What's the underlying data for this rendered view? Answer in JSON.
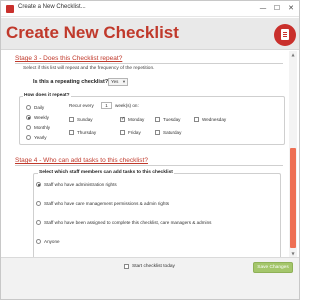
{
  "window": {
    "title": "Create a New Checklist...",
    "controls": {
      "minimize": "—",
      "maximize": "☐",
      "close": "✕"
    }
  },
  "header": {
    "title": "Create New Checklist",
    "logo_icon": "checklist-document-icon",
    "brand_color": "#c0392b"
  },
  "stage3": {
    "heading": "Stage 3 - Does this Checklist repeat?",
    "description": "Select if this list will repeat and the frequency of the repetition.",
    "repeating_label": "Is this a repeating checklist?:",
    "repeating_value": "Yes",
    "repeat_box": {
      "legend": "How does it repeat?",
      "frequencies": [
        {
          "label": "Daily",
          "selected": false
        },
        {
          "label": "Weekly",
          "selected": true
        },
        {
          "label": "Monthly",
          "selected": false
        },
        {
          "label": "Yearly",
          "selected": false
        }
      ],
      "recur_prefix": "Recur every",
      "recur_value": "1",
      "recur_suffix": "week(s) on:",
      "days": [
        {
          "label": "Sunday",
          "checked": false
        },
        {
          "label": "Monday",
          "checked": true
        },
        {
          "label": "Tuesday",
          "checked": false
        },
        {
          "label": "Wednesday",
          "checked": false
        },
        {
          "label": "Thursday",
          "checked": false
        },
        {
          "label": "Friday",
          "checked": false
        },
        {
          "label": "Saturday",
          "checked": false
        }
      ]
    }
  },
  "stage4": {
    "heading": "Stage 4 - Who can add tasks to this checklist?",
    "box_legend": "Select which staff members can add tasks to this checklist",
    "options": [
      {
        "label": "Staff who have administration rights",
        "selected": true
      },
      {
        "label": "Staff who have care management permissions & admin rights",
        "selected": false
      },
      {
        "label": "Staff who have been assigned to complete this checklist, care managers & admins",
        "selected": false
      },
      {
        "label": "Anyone",
        "selected": false
      }
    ]
  },
  "footer": {
    "start_today_label": "Start checklist today",
    "start_today_checked": false,
    "save_label": "Save Changes"
  },
  "colors": {
    "accent_red": "#c0392b",
    "scroll_thumb": "#ee6f53",
    "save_button": "#a4c66b"
  }
}
